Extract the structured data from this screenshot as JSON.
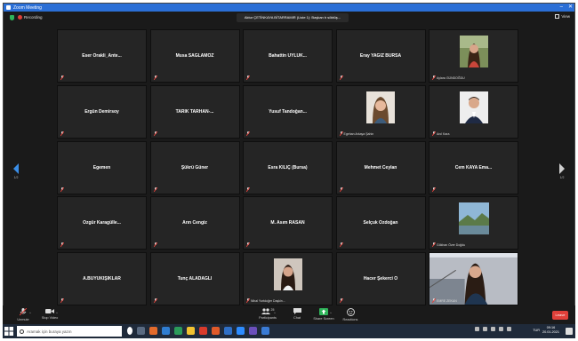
{
  "window": {
    "title": "Zoom Meeting"
  },
  "top": {
    "recording_label": "Recording",
    "banner": "Aktur ÇETİNKAYA BİTARRAMIR (Liste 1): Başkan b söktüş...",
    "view_label": "View"
  },
  "participants": [
    {
      "name": "Eser Orakli_Ante...",
      "caption": ""
    },
    {
      "name": "Musa SAĞLAMÖZ",
      "caption": ""
    },
    {
      "name": "Bahattin UYLUK...",
      "caption": ""
    },
    {
      "name": "Eray YAĞIZ BURSA",
      "caption": ""
    },
    {
      "name": "",
      "caption": "Aylara GÜNDOĞDU",
      "photo": "woman-long-hair"
    },
    {
      "name": "Ergün Demirsoy",
      "caption": ""
    },
    {
      "name": "TARIK TARHAN-...",
      "caption": ""
    },
    {
      "name": "Yusuf Tandoğan...",
      "caption": ""
    },
    {
      "name": "",
      "caption": "Egehan Arkaya Şahin",
      "photo": "woman-smile"
    },
    {
      "name": "",
      "caption": "Anıl Kara",
      "photo": "man-suit"
    },
    {
      "name": "Egemen",
      "caption": ""
    },
    {
      "name": "Şükrü Güner",
      "caption": ""
    },
    {
      "name": "Esra KILIÇ (Bursa)",
      "caption": ""
    },
    {
      "name": "Mehmet Ceylan",
      "caption": ""
    },
    {
      "name": "Cem KAYA Ema...",
      "caption": ""
    },
    {
      "name": "Özgür Karagülle...",
      "caption": ""
    },
    {
      "name": "Arın Cengiz",
      "caption": ""
    },
    {
      "name": "M. Asım RASAN",
      "caption": ""
    },
    {
      "name": "Selçuk Özdoğan",
      "caption": ""
    },
    {
      "name": "",
      "caption": "Gökhan Özer Doğdu",
      "photo": "landscape"
    },
    {
      "name": "A.BÜYÜKIŞIKLAR",
      "caption": ""
    },
    {
      "name": "Tunç ALADAĞLI",
      "caption": ""
    },
    {
      "name": "",
      "caption": "Nihal Yurtdoğer Daşkin...",
      "photo": "woman-dark"
    },
    {
      "name": "Hacer Şekerci Ö",
      "caption": ""
    },
    {
      "name": "",
      "caption": "EMRE ZEKAN",
      "photo": "woman-video"
    }
  ],
  "nav": {
    "left_page": "1/2",
    "right_page": "1/2"
  },
  "toolbar": {
    "unmute": "Unmute",
    "start_video": "Stop Video",
    "participants": "Participants",
    "participants_count": "25",
    "chat": "Chat",
    "share_screen": "Share Screen",
    "reactions": "Reactions",
    "end": "Leave"
  },
  "taskbar": {
    "search_placeholder": "Aramak için buraya yazın",
    "lang": "TUR",
    "time": "09:16",
    "date": "20.01.2021"
  }
}
